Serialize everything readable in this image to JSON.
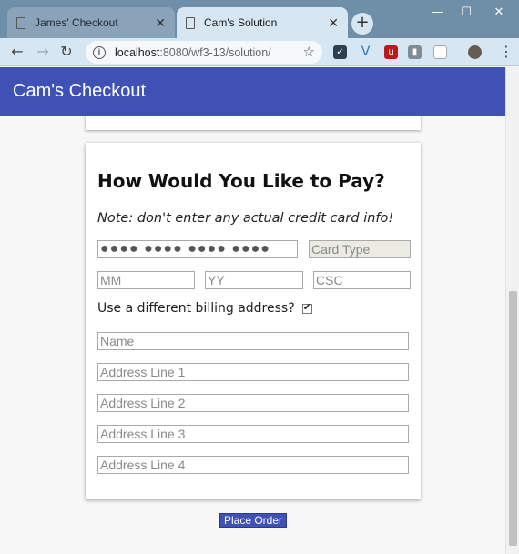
{
  "browser": {
    "tabs": [
      {
        "title": "James' Checkout",
        "active": false
      },
      {
        "title": "Cam's Solution",
        "active": true
      }
    ],
    "new_tab": "+",
    "window_controls": {
      "minimize": "—",
      "maximize": "☐",
      "close": "✕"
    },
    "address": {
      "host": "localhost",
      "rest": ":8080/wf3-13/solution/"
    }
  },
  "app": {
    "title": "Cam's Checkout",
    "header_color": "#3f51b5"
  },
  "payment": {
    "heading": "How Would You Like to Pay?",
    "note": "Note: don't enter any actual credit card info!",
    "card_number": "●●●● ●●●● ●●●● ●●●●",
    "card_type_placeholder": "Card Type",
    "month_placeholder": "MM",
    "year_placeholder": "YY",
    "csc_placeholder": "CSC",
    "billing_label": "Use a different billing address?",
    "billing_checked": true,
    "name_placeholder": "Name",
    "address1_placeholder": "Address Line 1",
    "address2_placeholder": "Address Line 2",
    "address3_placeholder": "Address Line 3",
    "address4_placeholder": "Address Line 4"
  },
  "actions": {
    "place_order": "Place Order"
  }
}
